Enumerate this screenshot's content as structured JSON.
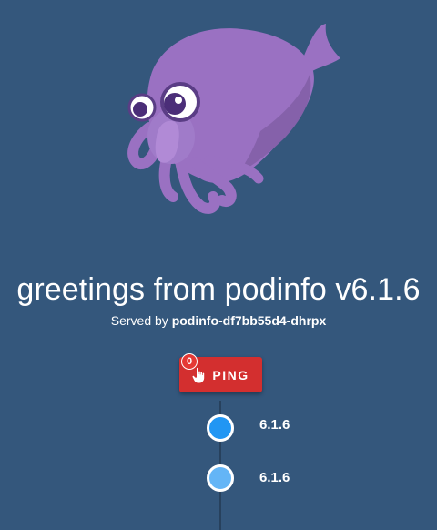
{
  "header": {
    "title": "greetings from podinfo v6.1.6",
    "served_prefix": "Served by",
    "hostname": "podinfo-df7bb55d4-dhrpx"
  },
  "mascot": {
    "icon": "cuttlefish-mascot-icon"
  },
  "ping": {
    "label": "PING",
    "count": "0",
    "icon": "touch-icon",
    "color": "#d32f2f"
  },
  "timeline": {
    "items": [
      {
        "version": "6.1.6",
        "color": "#2196f3"
      },
      {
        "version": "6.1.6",
        "color": "#64b5f6"
      }
    ]
  },
  "theme": {
    "background": "#34577c"
  }
}
